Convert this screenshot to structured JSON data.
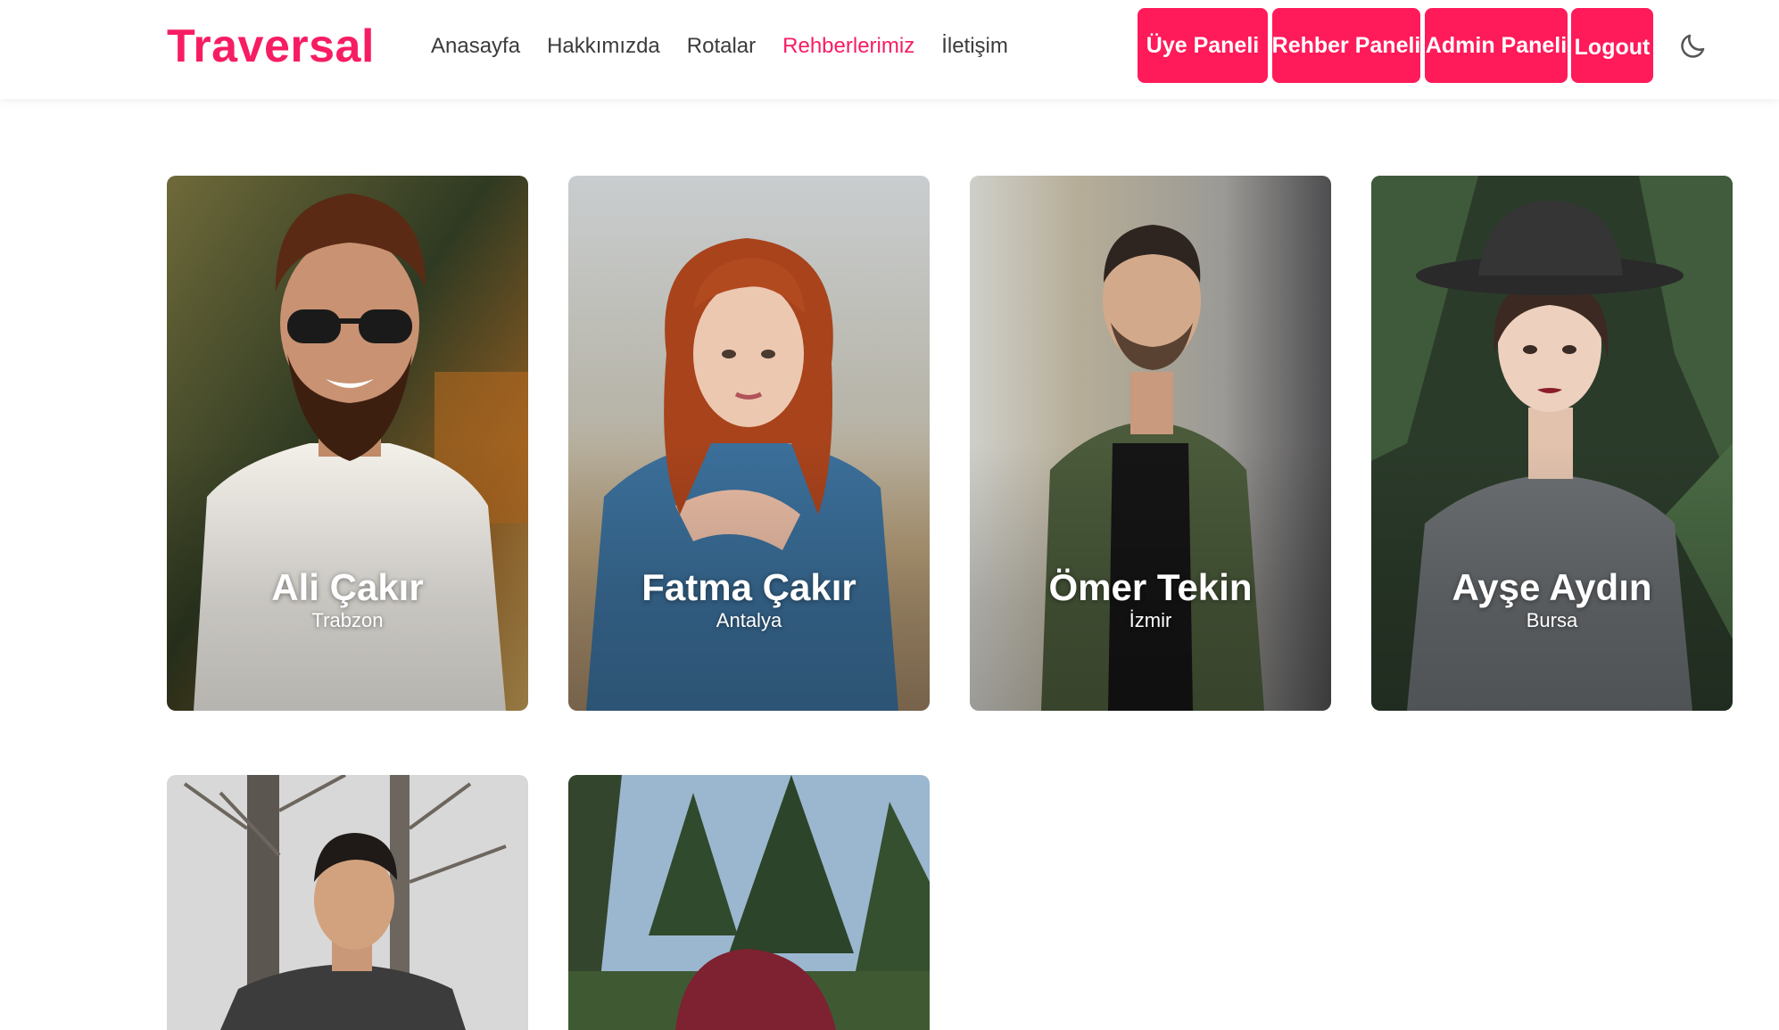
{
  "brand": {
    "name": "Traversal",
    "color": "#f71d63"
  },
  "nav": {
    "links": [
      {
        "label": "Anasayfa",
        "active": false
      },
      {
        "label": "Hakkımızda",
        "active": false
      },
      {
        "label": "Rotalar",
        "active": false
      },
      {
        "label": "Rehberlerimiz",
        "active": true
      },
      {
        "label": "İletişim",
        "active": false
      }
    ],
    "buttons": {
      "uye": "Üye Paneli",
      "rehber": "Rehber Paneli",
      "admin": "Admin Paneli",
      "logout": "Logout"
    },
    "button_color": "#ff1a5a",
    "theme_toggle_icon": "moon-icon"
  },
  "guides": [
    {
      "name": "Ali Çakır",
      "city": "Trabzon"
    },
    {
      "name": "Fatma Çakır",
      "city": "Antalya"
    },
    {
      "name": "Ömer Tekin",
      "city": "İzmir"
    },
    {
      "name": "Ayşe Aydın",
      "city": "Bursa"
    },
    {
      "name": "",
      "city": ""
    },
    {
      "name": "",
      "city": ""
    }
  ]
}
